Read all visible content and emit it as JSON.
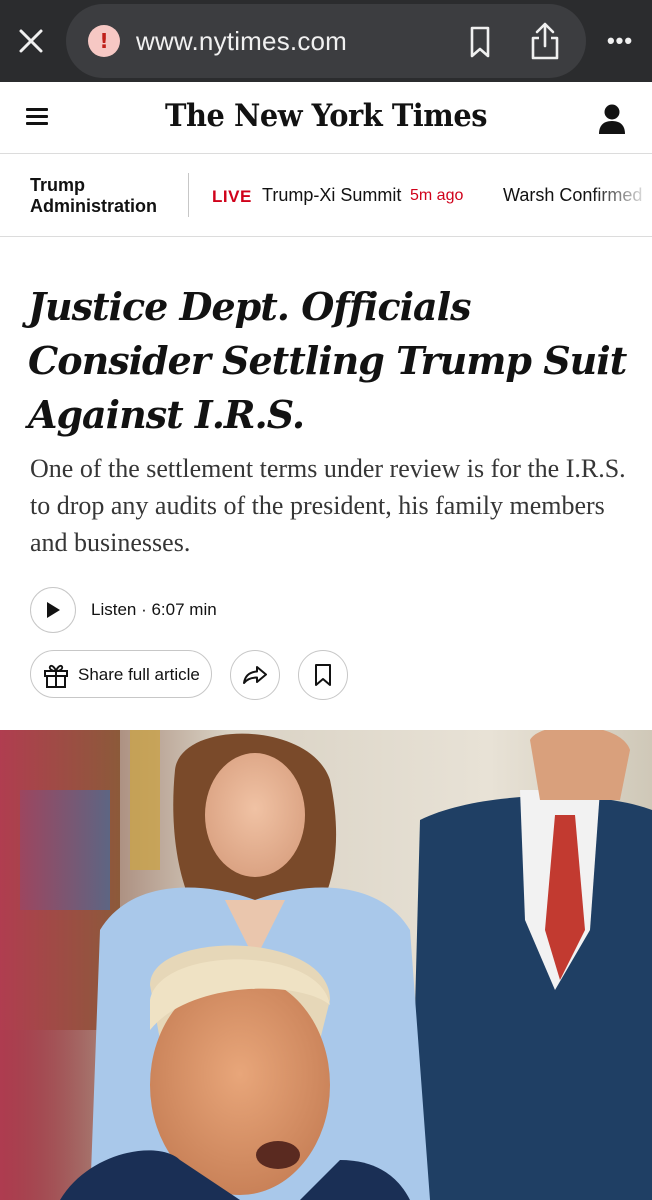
{
  "browser": {
    "url": "www.nytimes.com"
  },
  "header": {
    "masthead": "The New York Times"
  },
  "subnav": {
    "section": "Trump Administration",
    "live_label": "LIVE",
    "story1": "Trump-Xi Summit",
    "story1_time": "5m ago",
    "story2": "Warsh Confirmed"
  },
  "article": {
    "headline": "Justice Dept. Officials Consider Settling Trump Suit Against I.R.S.",
    "summary": "One of the settlement terms under review is for the I.R.S. to drop any audits of the president, his family members and businesses.",
    "listen": "Listen · 6:07 min",
    "share_label": "Share full article"
  },
  "colors": {
    "brand_red": "#d0021b",
    "chrome_bg": "#2b2c2e",
    "text": "#121212"
  },
  "icons": {
    "close": "close-icon",
    "warning": "warning-icon",
    "bookmark": "bookmark-icon",
    "share": "share-icon",
    "more": "more-icon",
    "menu": "menu-icon",
    "account": "account-icon",
    "play": "play-icon",
    "gift": "gift-icon",
    "forward": "forward-icon",
    "save": "save-icon"
  }
}
